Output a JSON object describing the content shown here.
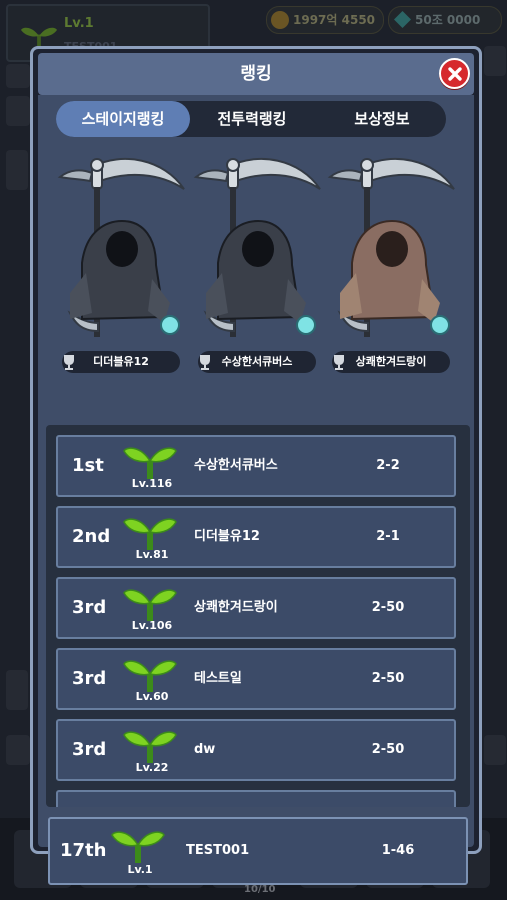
{
  "background": {
    "profile": {
      "level": "Lv.1",
      "name": "TEST001"
    },
    "currency": {
      "gold": "1997억 4550",
      "gems": "50조 0000"
    },
    "bottom_counter": "10/10"
  },
  "modal": {
    "title": "랭킹",
    "close_icon": "close-icon"
  },
  "tabs": [
    {
      "label": "스테이지랭킹",
      "active": true
    },
    {
      "label": "전투력랭킹",
      "active": false
    },
    {
      "label": "보상정보",
      "active": false
    }
  ],
  "podium": [
    {
      "name": "디더블유12"
    },
    {
      "name": "수상한서큐버스"
    },
    {
      "name": "상쾌한겨드랑이"
    }
  ],
  "rankings": [
    {
      "rank": "1st",
      "level": "Lv.116",
      "name": "수상한서큐버스",
      "stage": "2-2"
    },
    {
      "rank": "2nd",
      "level": "Lv.81",
      "name": "디더블유12",
      "stage": "2-1"
    },
    {
      "rank": "3rd",
      "level": "Lv.106",
      "name": "상쾌한겨드랑이",
      "stage": "2-50"
    },
    {
      "rank": "3rd",
      "level": "Lv.60",
      "name": "테스트일",
      "stage": "2-50"
    },
    {
      "rank": "3rd",
      "level": "Lv.22",
      "name": "dw",
      "stage": "2-50"
    }
  ],
  "my_rank": {
    "rank": "17th",
    "level": "Lv.1",
    "name": "TEST001",
    "stage": "1-46"
  },
  "colors": {
    "accent": "#5f7eb4",
    "close": "#d6292d",
    "sprout": "#7ed321"
  }
}
